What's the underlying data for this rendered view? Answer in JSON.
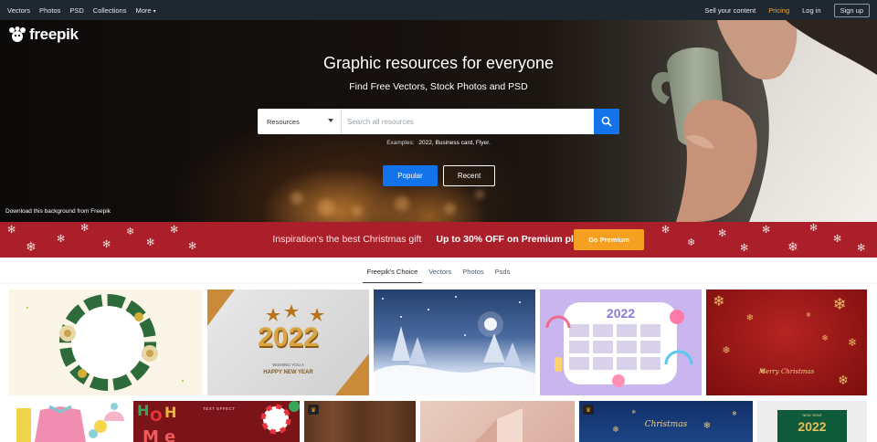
{
  "nav": {
    "left": [
      "Vectors",
      "Photos",
      "PSD",
      "Collections",
      "More"
    ],
    "sell": "Sell your content",
    "pricing": "Pricing",
    "login": "Log in",
    "signup": "Sign up"
  },
  "hero": {
    "logo": "freepik",
    "title": "Graphic resources for everyone",
    "subtitle": "Find Free Vectors, Stock Photos and PSD",
    "search": {
      "selected": "Resources",
      "placeholder": "Search all resources"
    },
    "examples_label": "Examples:",
    "examples": "2022, Business card, Flyer.",
    "popular": "Popular",
    "recent": "Recent",
    "download_bg": "Download this background from Freepik"
  },
  "promo": {
    "text": "Inspiration's the best Christmas gift",
    "offer": "Up to 30% OFF on Premium plans",
    "button": "Go Premium"
  },
  "content_tabs": [
    "Freepik's Choice",
    "Vectors",
    "Photos",
    "Psds"
  ],
  "gallery_text": {
    "year_2022": "2022",
    "wishing": "WISHING YOU A",
    "happy_new_year": "HAPPY NEW YEAR",
    "calendar_year": "2022",
    "merry_christmas": "Merry Christmas",
    "text_effect": "TEXT EFFECT",
    "christmas_script": "Christmas",
    "new_year_small": "NEW YEAR",
    "year_2022_b": "2022"
  },
  "colors": {
    "nav_bg": "#1f2730",
    "accent_blue": "#1273eb",
    "promo_red": "#ab1f2a",
    "premium_orange": "#f6a021"
  }
}
